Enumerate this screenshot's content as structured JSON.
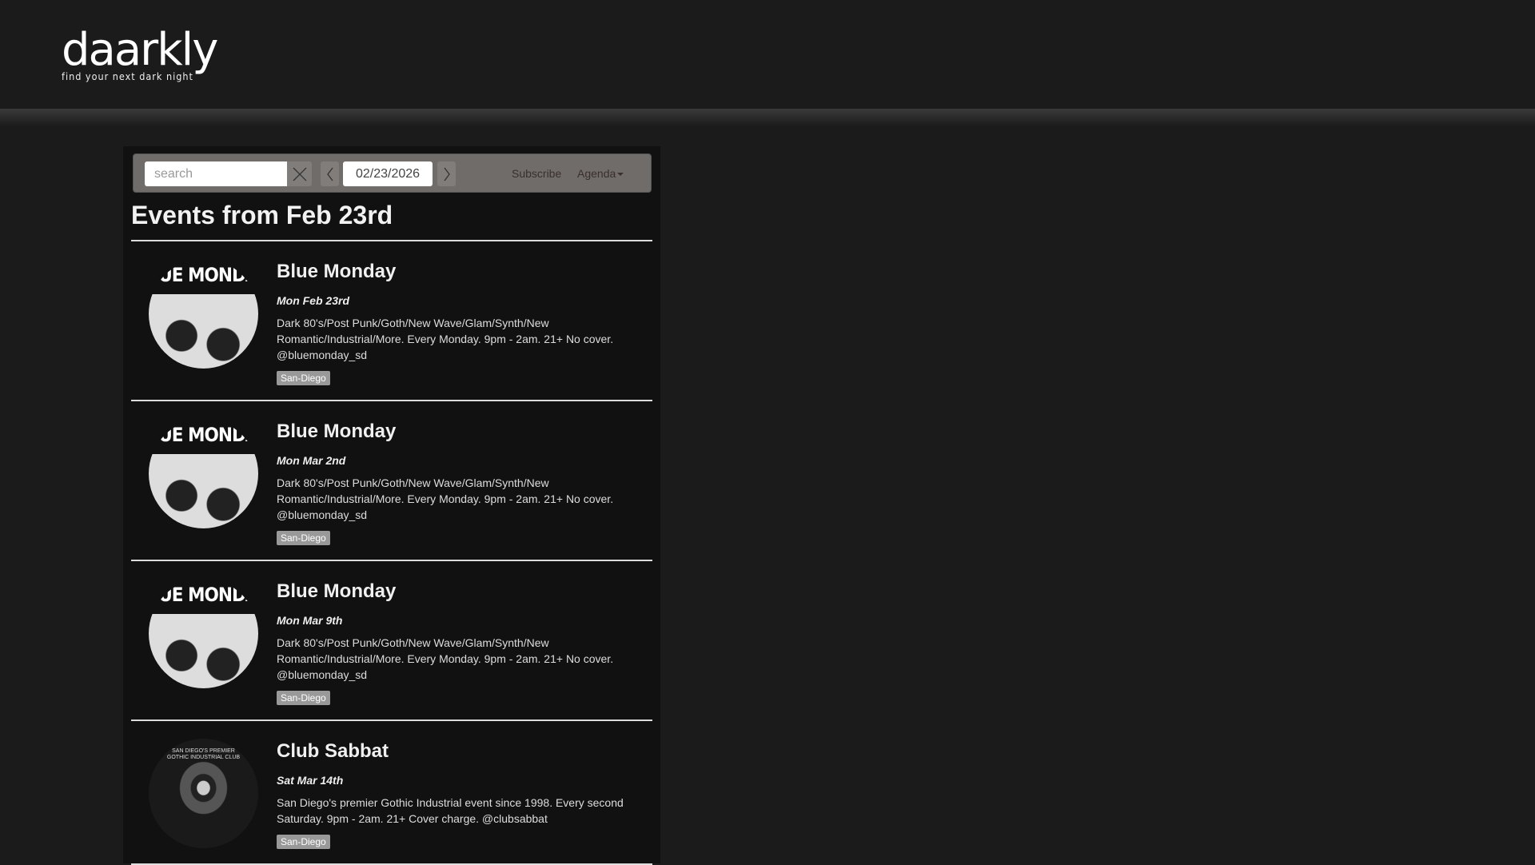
{
  "header": {
    "logo": "daarkly",
    "tagline": "find your next dark night"
  },
  "toolbar": {
    "search_placeholder": "search",
    "date_value": "02/23/2026",
    "subscribe": "Subscribe",
    "view": "Agenda"
  },
  "page_title": "Events from Feb 23rd",
  "events": [
    {
      "title": "Blue Monday",
      "date": "Mon Feb 23rd",
      "description": "Dark 80's/Post Punk/Goth/New Wave/Glam/Synth/New Romantic/Industrial/More. Every Monday. 9pm - 2am. 21+ No cover. @bluemonday_sd",
      "tag": "San-Diego",
      "image_text": "BLUE MONDAY"
    },
    {
      "title": "Blue Monday",
      "date": "Mon Mar 2nd",
      "description": "Dark 80's/Post Punk/Goth/New Wave/Glam/Synth/New Romantic/Industrial/More. Every Monday. 9pm - 2am. 21+ No cover. @bluemonday_sd",
      "tag": "San-Diego",
      "image_text": "BLUE MONDAY"
    },
    {
      "title": "Blue Monday",
      "date": "Mon Mar 9th",
      "description": "Dark 80's/Post Punk/Goth/New Wave/Glam/Synth/New Romantic/Industrial/More. Every Monday. 9pm - 2am. 21+ No cover. @bluemonday_sd",
      "tag": "San-Diego",
      "image_text": "BLUE MONDAY"
    },
    {
      "title": "Club Sabbat",
      "date": "Sat Mar 14th",
      "description": "San Diego's premier Gothic Industrial event since 1998. Every second Saturday. 9pm - 2am. 21+ Cover charge. @clubsabbat",
      "tag": "San-Diego",
      "image_text": "SAN DIEGO'S PREMIER GOTHIC INDUSTRIAL CLUB"
    }
  ]
}
